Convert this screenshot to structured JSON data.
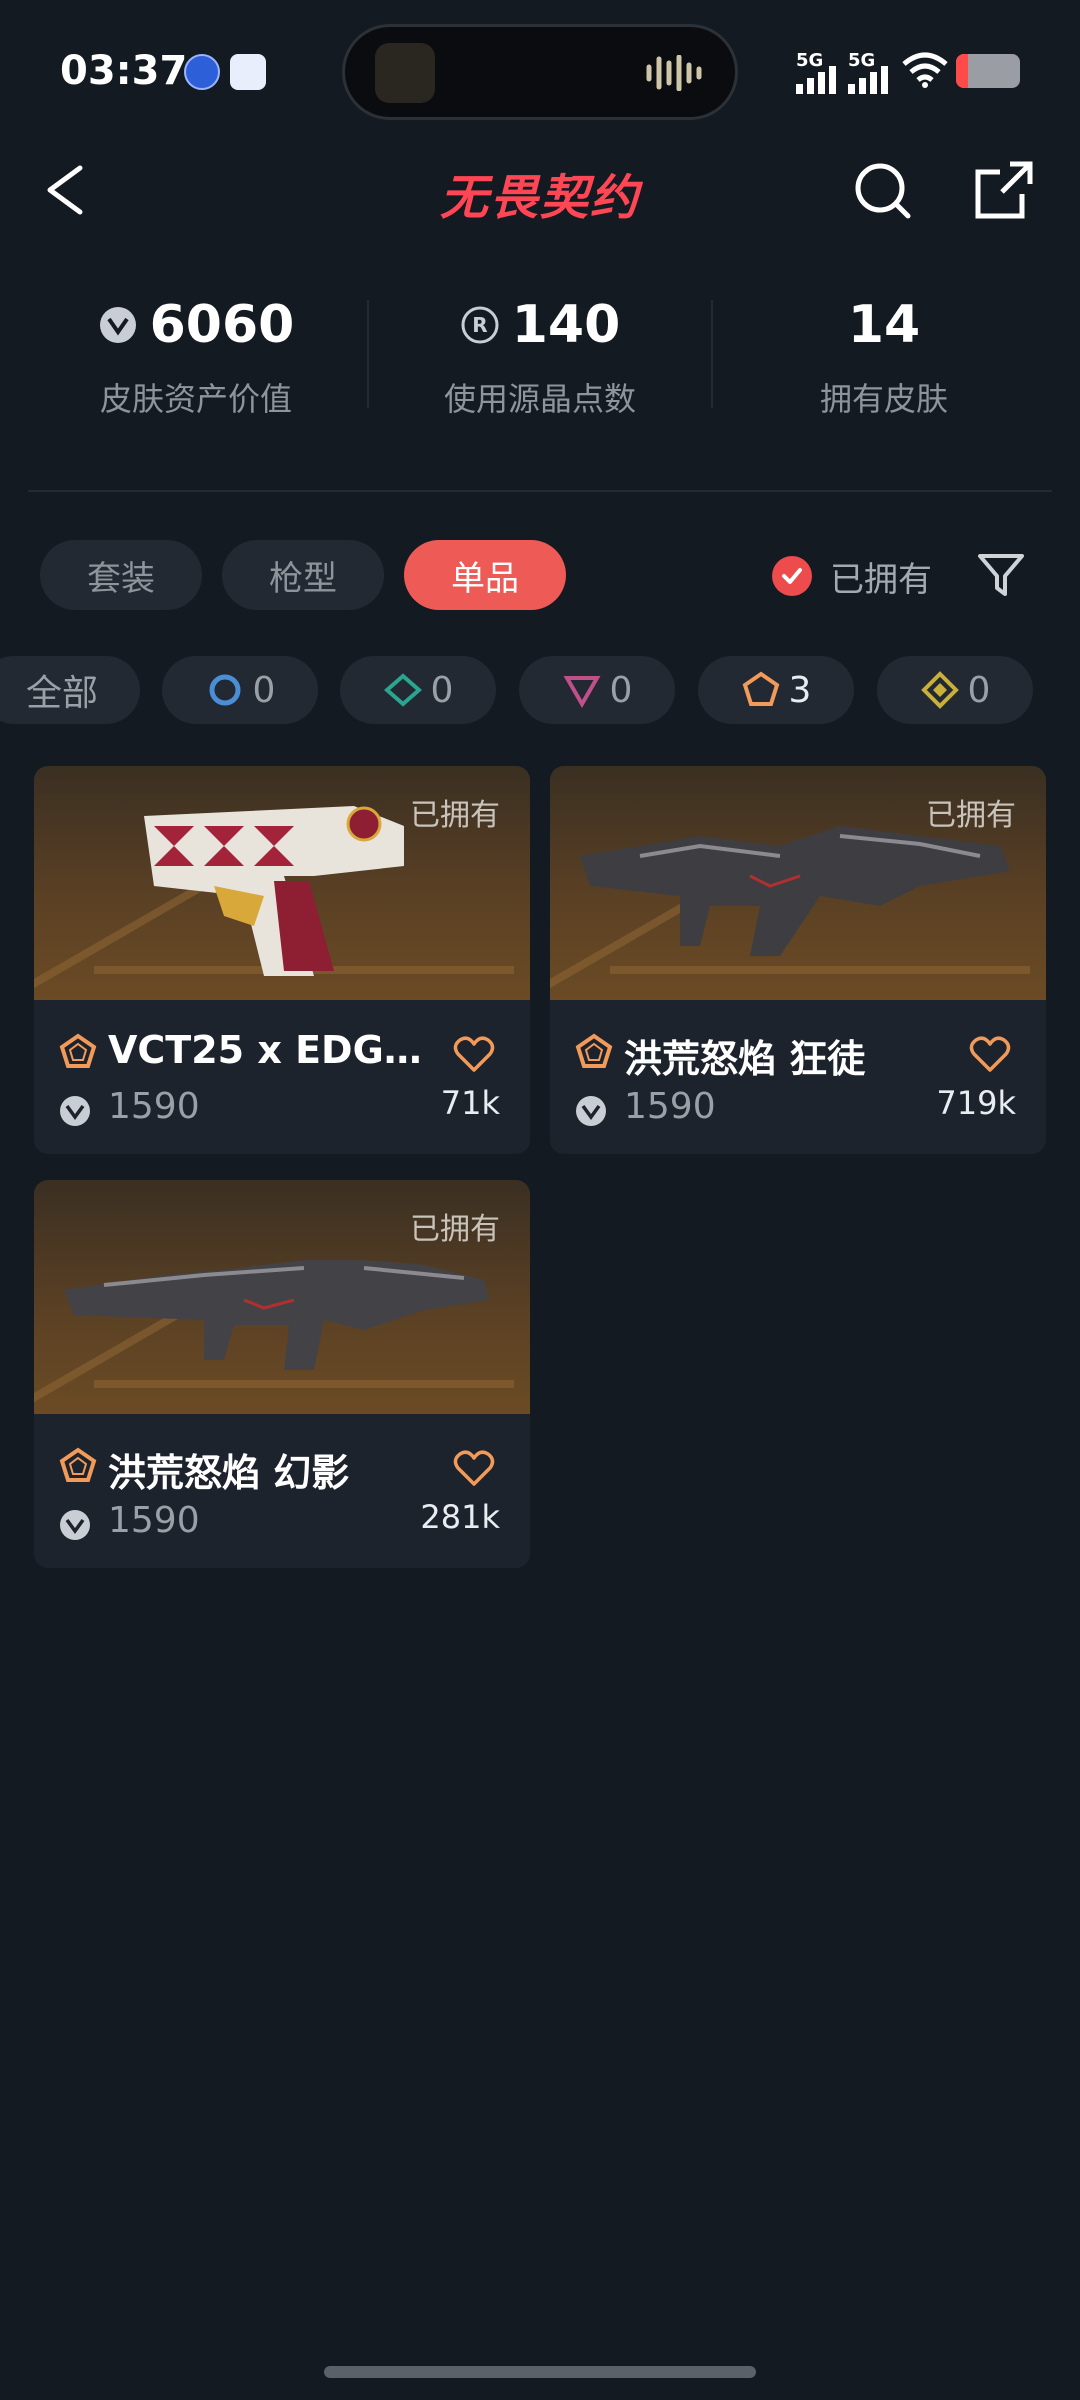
{
  "status_bar": {
    "time": "03:37",
    "network1": "5G",
    "network2": "5G"
  },
  "header": {
    "app_title": "无畏契约"
  },
  "stats": [
    {
      "value": "6060",
      "label": "皮肤资产价值",
      "icon": "vp-coin-icon"
    },
    {
      "value": "140",
      "label": "使用源晶点数",
      "icon": "radianite-coin-icon"
    },
    {
      "value": "14",
      "label": "拥有皮肤"
    }
  ],
  "tabs": [
    {
      "label": "套装",
      "active": false
    },
    {
      "label": "枪型",
      "active": false
    },
    {
      "label": "单品",
      "active": true
    }
  ],
  "owned_filter": {
    "label": "已拥有",
    "checked": true
  },
  "rarity_chips": [
    {
      "label": "全部"
    },
    {
      "count": "0",
      "tier": "select",
      "color": "#4a8ed6"
    },
    {
      "count": "0",
      "tier": "deluxe",
      "color": "#2aa58f"
    },
    {
      "count": "0",
      "tier": "premium",
      "color": "#c0508a"
    },
    {
      "count": "3",
      "tier": "exclusive",
      "color": "#f29a5a"
    },
    {
      "count": "0",
      "tier": "ultra",
      "color": "#c9b03a"
    }
  ],
  "cards": [
    {
      "owned": "已拥有",
      "title": "VCT25 x EDG…",
      "price": "1590",
      "likes": "71k",
      "weapon": "pistol-icon"
    },
    {
      "owned": "已拥有",
      "title": "洪荒怒焰 狂徒",
      "price": "1590",
      "likes": "719k",
      "weapon": "rifle-icon"
    },
    {
      "owned": "已拥有",
      "title": "洪荒怒焰 幻影",
      "price": "1590",
      "likes": "281k",
      "weapon": "rifle-icon"
    }
  ],
  "colors": {
    "accent": "#ee5a55",
    "background": "#141a22",
    "card": "#1d232c",
    "tier_exclusive": "#f29a5a"
  }
}
